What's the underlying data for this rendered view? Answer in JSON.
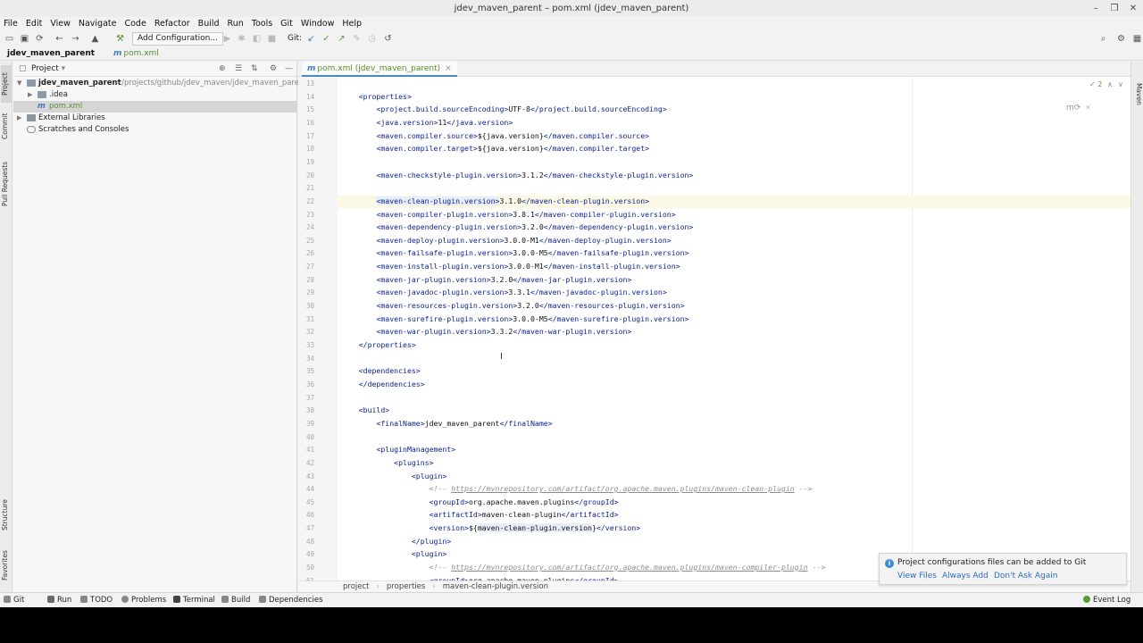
{
  "window": {
    "title": "jdev_maven_parent – pom.xml (jdev_maven_parent)"
  },
  "menu": [
    "File",
    "Edit",
    "View",
    "Navigate",
    "Code",
    "Refactor",
    "Build",
    "Run",
    "Tools",
    "Git",
    "Window",
    "Help"
  ],
  "toolbar": {
    "add_configuration": "Add Configuration...",
    "git_label": "Git:"
  },
  "navbar": {
    "project": "jdev_maven_parent",
    "file": "pom.xml"
  },
  "left_strip": [
    "Project",
    "Commit",
    "Pull Requests",
    "Structure",
    "Favorites"
  ],
  "project_panel": {
    "title": "Project",
    "tree": {
      "root_name": "jdev_maven_parent",
      "root_path": "~/projects/github/jdev_maven/jdev_maven_parent",
      "idea": ".idea",
      "pom": "pom.xml",
      "external": "External Libraries",
      "scratches": "Scratches and Consoles"
    }
  },
  "editor": {
    "tab_label": "pom.xml (jdev_maven_parent)",
    "inspection_count": "2",
    "first_line": 13,
    "current_line": 22
  },
  "breadcrumb": [
    "project",
    "properties",
    "maven-clean-plugin.version"
  ],
  "right_strip": {
    "label": "Maven"
  },
  "notification": {
    "message": "Project configurations files can be added to Git",
    "actions": [
      "View Files",
      "Always Add",
      "Don't Ask Again"
    ]
  },
  "statusbar": {
    "items": [
      "Git",
      "Run",
      "TODO",
      "Problems",
      "Terminal",
      "Build",
      "Dependencies"
    ],
    "event_log": "Event Log"
  }
}
